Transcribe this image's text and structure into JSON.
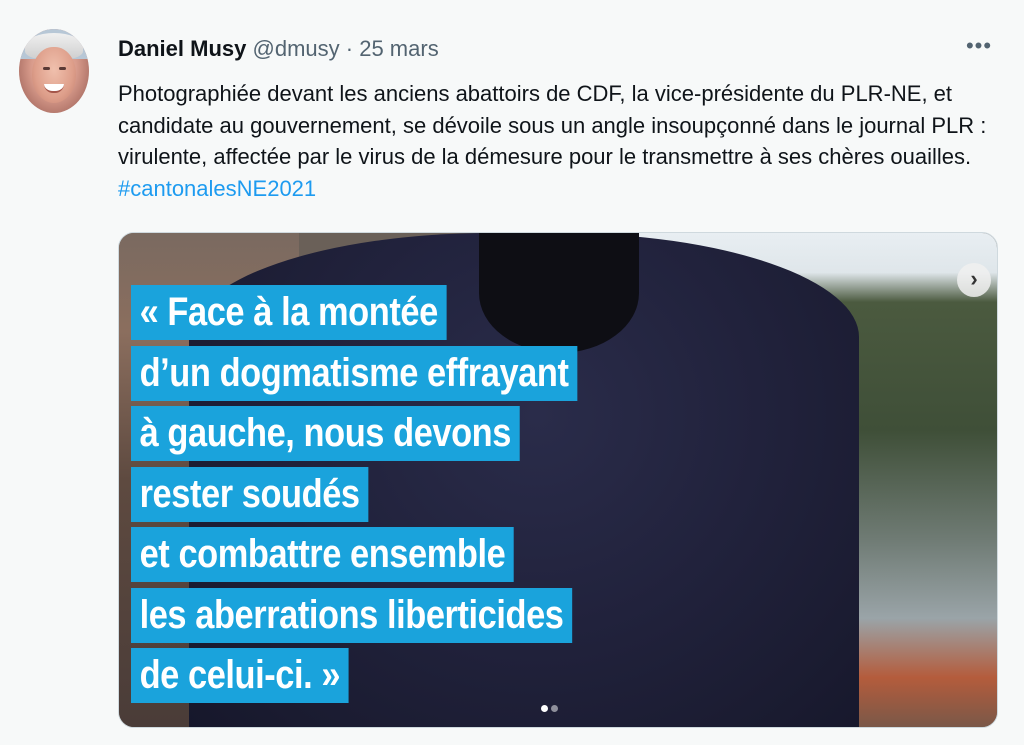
{
  "author": {
    "name": "Daniel Musy",
    "handle": "@dmusy",
    "separator": "·",
    "date": "25 mars"
  },
  "more_label": "•••",
  "tweet": {
    "text": "Photographiée devant les anciens abattoirs de CDF, la vice-présidente du PLR-NE, et candidate au gouvernement, se dévoile sous un angle insoupçonné dans le journal PLR : virulente, affectée par le virus de la démesure pour le transmettre à ses chères ouailles.",
    "hashtag": "#cantonalesNE2021"
  },
  "media": {
    "quote_lines": [
      "« Face à la montée",
      "d’un dogmatisme effrayant",
      "à gauche, nous devons",
      "rester soudés",
      "et combattre ensemble",
      "les aberrations liberticides",
      "de celui-ci. »"
    ],
    "next_icon": "›",
    "carousel": {
      "current": 1,
      "total": 2
    }
  },
  "colors": {
    "hashtag": "#1d9bf0",
    "quote_bg": "#1aa3dc",
    "background": "#f7f9f9"
  }
}
